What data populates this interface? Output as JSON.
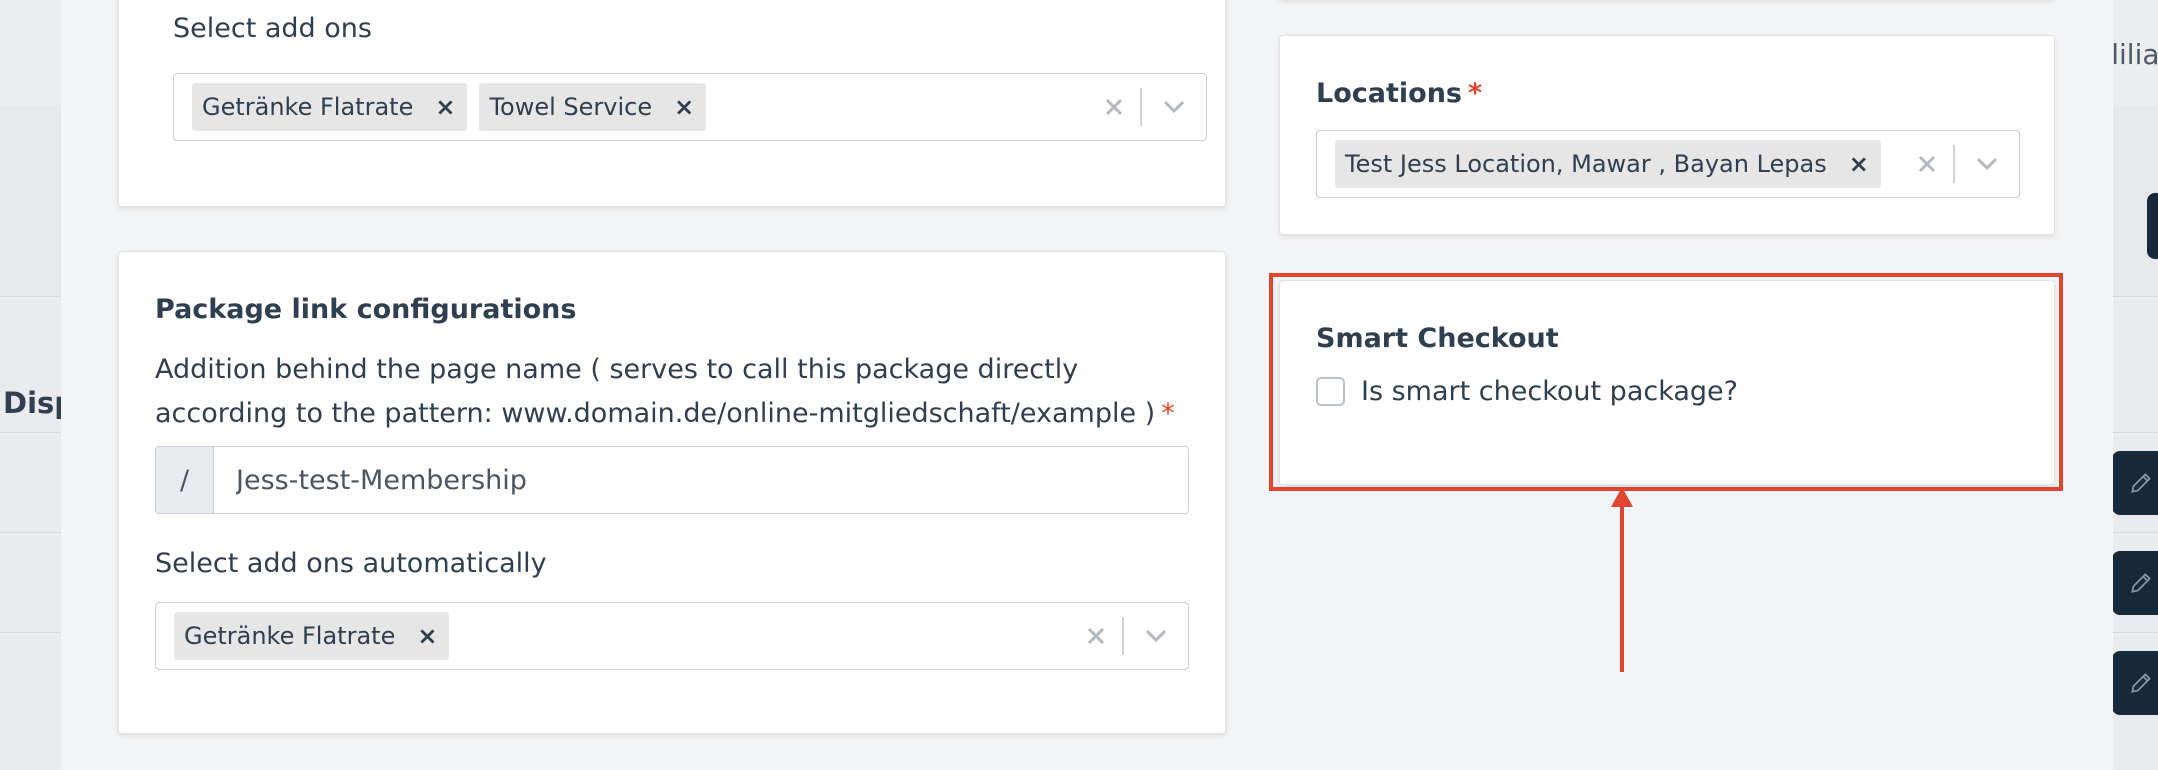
{
  "background": {
    "left_text": "Disp",
    "right_text": "elilia"
  },
  "addons_card": {
    "label": "Select add ons",
    "chips": [
      "Getränke Flatrate",
      "Towel Service"
    ],
    "chip_remove": "×",
    "clear": "×"
  },
  "package_link": {
    "heading": "Package link configurations",
    "description": "Addition behind the page name ( serves to call this package directly according to the pattern: www.domain.de/online-mitgliedschaft/example )",
    "required_mark": "*",
    "prefix": "/",
    "value": "Jess-test-Membership"
  },
  "addons_auto": {
    "label": "Select add ons automatically",
    "chips": [
      "Getränke Flatrate"
    ]
  },
  "locations": {
    "label": "Locations",
    "required_mark": "*",
    "chips": [
      "Test Jess Location, Mawar , Bayan Lepas"
    ]
  },
  "smart_checkout": {
    "heading": "Smart Checkout",
    "checkbox_label": "Is smart checkout package?",
    "checked": false
  },
  "colors": {
    "accent_red": "#e2452f",
    "dark_navy": "#17283a"
  }
}
